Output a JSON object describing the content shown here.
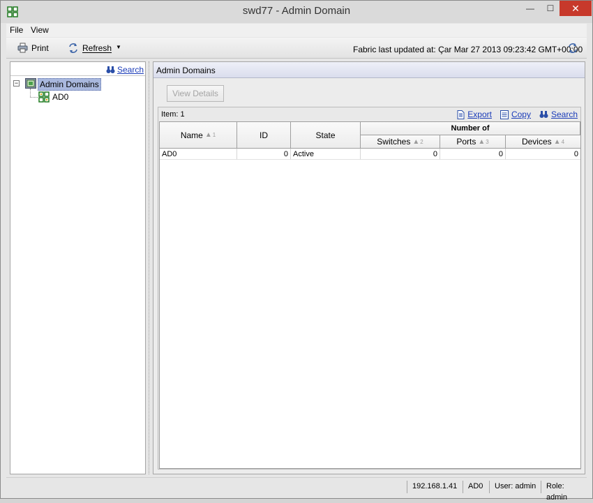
{
  "window": {
    "title": "swd77 - Admin Domain",
    "close_glyph": "✕",
    "minimize_glyph": "—",
    "maximize_glyph": "☐"
  },
  "menu": {
    "items": [
      {
        "label": "File"
      },
      {
        "label": "View"
      }
    ]
  },
  "toolbar": {
    "print_label": "Print",
    "refresh_label": "Refresh",
    "dropdown_glyph": "▼",
    "fabric_status": "Fabric last updated at: Çar Mar 27 2013 09:23:42 GMT+00:00"
  },
  "tree": {
    "search_label": "Search",
    "expander_glyph": "−",
    "root": {
      "label": "Admin Domains"
    },
    "children": [
      {
        "label": "AD0"
      }
    ]
  },
  "panel": {
    "title": "Admin Domains",
    "view_details_label": "View Details",
    "item_count": "Item: 1",
    "actions": {
      "export_label": "Export",
      "copy_label": "Copy",
      "search_label": "Search"
    }
  },
  "table": {
    "group_header": "Number of",
    "columns": {
      "name": {
        "label": "Name",
        "sort": "1"
      },
      "id": {
        "label": "ID"
      },
      "state": {
        "label": "State"
      },
      "switches": {
        "label": "Switches",
        "sort": "2"
      },
      "ports": {
        "label": "Ports",
        "sort": "3"
      },
      "devices": {
        "label": "Devices",
        "sort": "4"
      }
    },
    "sort_arrow": "▲",
    "rows": [
      {
        "name": "AD0",
        "id": "0",
        "state": "Active",
        "switches": "0",
        "ports": "0",
        "devices": "0"
      }
    ]
  },
  "status": {
    "ip": "192.168.1.41",
    "domain": "AD0",
    "user": "User: admin",
    "role": "Role: admin"
  },
  "colors": {
    "link": "#1a3bb8",
    "tree_selection": "#a9b8de",
    "close_button": "#c7392b"
  }
}
